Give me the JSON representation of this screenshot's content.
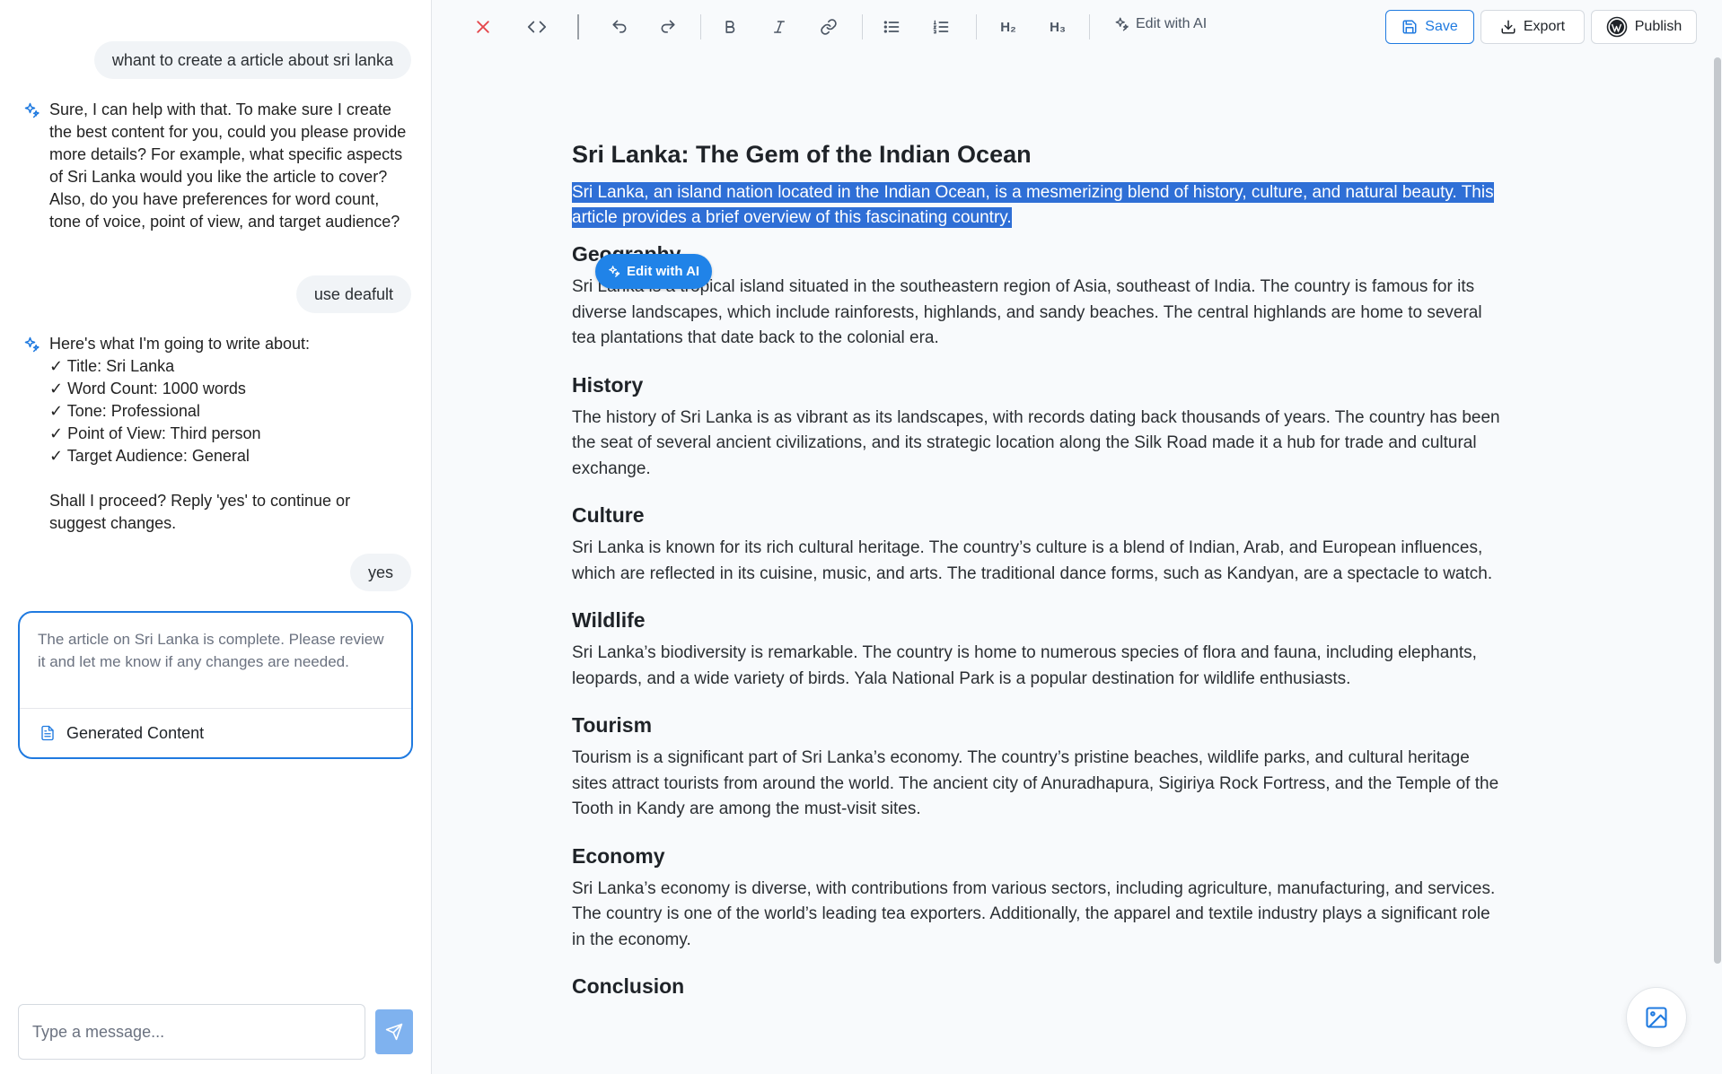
{
  "chat": {
    "messages": [
      {
        "role": "user",
        "text": "whant to create  a article about sri lanka"
      },
      {
        "role": "assistant",
        "text": "Sure, I can help with that. To make sure I create the best content for you, could you please provide more details? For example, what specific aspects of Sri Lanka would you like the article to cover? Also, do you have preferences for word count, tone of voice, point of view, and target audience?"
      },
      {
        "role": "user",
        "text": "use deafult"
      },
      {
        "role": "assistant",
        "text": "Here's what I'm going to write about:\n✓ Title: Sri Lanka\n✓ Word Count: 1000 words\n✓ Tone: Professional\n✓ Point of View: Third person\n✓ Target Audience: General\n\nShall I proceed? Reply 'yes' to continue or suggest changes."
      },
      {
        "role": "user",
        "text": "yes"
      }
    ],
    "result_card": {
      "text": "The article on Sri Lanka is complete. Please review it and let me know if any changes are needed.",
      "link_label": "Generated Content"
    },
    "composer": {
      "placeholder": "Type a message...",
      "value": ""
    }
  },
  "toolbar": {
    "h2_label": "H₂",
    "h3_label": "H₃",
    "edit_ai_label": "Edit with AI",
    "save_label": "Save",
    "export_label": "Export",
    "publish_label": "Publish",
    "accent_color": "#1f7ae0",
    "close_color": "#e5484d"
  },
  "editor": {
    "title": "Sri Lanka: The Gem of the Indian Ocean",
    "intro": "Sri Lanka, an island nation located in the Indian Ocean, is a mesmerizing blend of history, culture, and natural beauty. This article provides a brief overview of this fascinating country.",
    "floating_button_label": "Edit with AI",
    "sections": [
      {
        "heading": "Geography",
        "body": "Sri Lanka is a tropical island situated in the southeastern region of Asia, southeast of India. The country is famous for its diverse landscapes, which include rainforests, highlands, and sandy beaches. The central highlands are home to several tea plantations that date back to the colonial era."
      },
      {
        "heading": "History",
        "body": "The history of Sri Lanka is as vibrant as its landscapes, with records dating back thousands of years. The country has been the seat of several ancient civilizations, and its strategic location along the Silk Road made it a hub for trade and cultural exchange."
      },
      {
        "heading": "Culture",
        "body": "Sri Lanka is known for its rich cultural heritage. The country’s culture is a blend of Indian, Arab, and European influences, which are reflected in its cuisine, music, and arts. The traditional dance forms, such as Kandyan, are a spectacle to watch."
      },
      {
        "heading": "Wildlife",
        "body": "Sri Lanka’s biodiversity is remarkable. The country is home to numerous species of flora and fauna, including elephants, leopards, and a wide variety of birds. Yala National Park is a popular destination for wildlife enthusiasts."
      },
      {
        "heading": "Tourism",
        "body": "Tourism is a significant part of Sri Lanka’s economy. The country’s pristine beaches, wildlife parks, and cultural heritage sites attract tourists from around the world. The ancient city of Anuradhapura, Sigiriya Rock Fortress, and the Temple of the Tooth in Kandy are among the must-visit sites."
      },
      {
        "heading": "Economy",
        "body": "Sri Lanka’s economy is diverse, with contributions from various sectors, including agriculture, manufacturing, and services. The country is one of the world’s leading tea exporters. Additionally, the apparel and textile industry plays a significant role in the economy."
      },
      {
        "heading": "Conclusion",
        "body": ""
      }
    ],
    "selection_color": "#2f6fd6"
  }
}
